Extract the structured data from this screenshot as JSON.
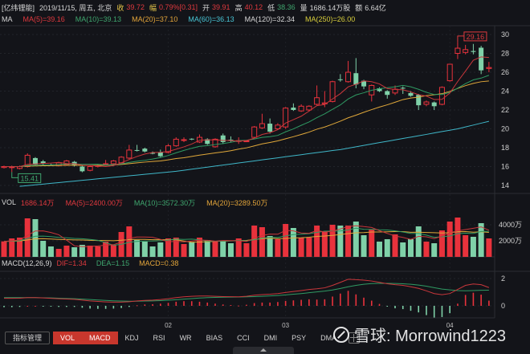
{
  "header": {
    "stock_name": "[亿纬锂能]",
    "date": "2019/11/15, 周五, 北京",
    "close_label": "收",
    "close": "39.72",
    "change_label": "幅",
    "change": "0.79%[0.31]",
    "open_label": "开",
    "open": "39.91",
    "high_label": "高",
    "high": "40.12",
    "low_label": "低",
    "low": "38.36",
    "volume_label": "量",
    "volume": "1686.14万股",
    "amount_label": "额",
    "amount": "6.64亿"
  },
  "ma_legend": {
    "title": "MA",
    "ma5": "MA(5)=39.16",
    "ma10": "MA(10)=39.13",
    "ma20": "MA(20)=37.10",
    "ma60": "MA(60)=36.13",
    "ma120": "MA(120)=32.34",
    "ma250": "MA(250)=26.00"
  },
  "vol_legend": {
    "title": "VOL",
    "value": "1686.14万",
    "ma5": "MA(5)=2400.00万",
    "ma10": "MA(10)=3572.30万",
    "ma20": "MA(20)=3289.50万"
  },
  "macd_legend": {
    "title": "MACD(12,26,9)",
    "dif": "DIF=1.34",
    "dea": "DEA=1.15",
    "macd": "MACD=0.38"
  },
  "tabs": [
    {
      "label": "指标管理",
      "active": false
    },
    {
      "label": "VOL",
      "active": true
    },
    {
      "label": "MACD",
      "active": true
    },
    {
      "label": "KDJ",
      "active": false
    },
    {
      "label": "RSI",
      "active": false
    },
    {
      "label": "WR",
      "active": false
    },
    {
      "label": "BIAS",
      "active": false
    },
    {
      "label": "CCI",
      "active": false
    },
    {
      "label": "DMI",
      "active": false
    },
    {
      "label": "PSY",
      "active": false
    },
    {
      "label": "DMA",
      "active": false
    }
  ],
  "watermark": "雪球: Morrowind1223",
  "colors": {
    "up": "#e8323c",
    "down": "#7fd1a8",
    "flat": "#e6e6e6",
    "ma5": "#c9373b",
    "ma10": "#2f9a63",
    "ma20": "#e0a83a",
    "ma60": "#3fb7c9",
    "bg": "#131419"
  },
  "chart_data": [
    {
      "type": "candlestick",
      "panel": "price",
      "y_ticks": [
        "30",
        "28",
        "26",
        "24",
        "22",
        "20",
        "18",
        "16",
        "14"
      ],
      "ylim": [
        13,
        31
      ],
      "x_tick_labels": [
        {
          "index": 21,
          "label": "02"
        },
        {
          "index": 36,
          "label": "03"
        },
        {
          "index": 57,
          "label": "04"
        }
      ],
      "annotations": [
        {
          "index": 1,
          "label": "15.41",
          "kind": "low"
        },
        {
          "index": 58,
          "label": "29.16",
          "kind": "high"
        }
      ],
      "ohlc": [
        [
          15.9,
          16.0,
          16.1,
          15.8
        ],
        [
          15.95,
          15.97,
          16.1,
          15.41
        ],
        [
          15.8,
          16.0,
          16.1,
          15.7
        ],
        [
          16.0,
          17.2,
          17.4,
          15.9
        ],
        [
          16.9,
          16.2,
          17.0,
          16.1
        ],
        [
          16.55,
          16.3,
          16.7,
          16.2
        ],
        [
          16.2,
          16.15,
          16.3,
          16.1
        ],
        [
          16.1,
          16.4,
          16.5,
          16.0
        ],
        [
          16.2,
          16.6,
          16.7,
          16.1
        ],
        [
          16.5,
          16.1,
          16.6,
          16.0
        ],
        [
          16.0,
          15.5,
          16.1,
          15.4
        ],
        [
          15.6,
          16.0,
          16.1,
          15.5
        ],
        [
          16.05,
          16.1,
          16.2,
          15.9
        ],
        [
          16.25,
          16.3,
          16.7,
          16.2
        ],
        [
          16.3,
          16.6,
          16.7,
          16.2
        ],
        [
          16.4,
          17.0,
          17.1,
          16.3
        ],
        [
          16.9,
          17.75,
          18.3,
          16.8
        ],
        [
          17.75,
          17.7,
          18.3,
          17.6
        ],
        [
          17.9,
          17.6,
          18.0,
          17.5
        ],
        [
          17.45,
          17.4,
          17.6,
          17.3
        ],
        [
          17.5,
          17.1,
          17.8,
          17.0
        ],
        [
          17.5,
          18.2,
          18.4,
          17.4
        ],
        [
          18.2,
          18.9,
          19.1,
          18.1
        ],
        [
          18.8,
          18.85,
          19.1,
          18.6
        ],
        [
          18.95,
          18.9,
          19.0,
          18.8
        ],
        [
          18.6,
          19.1,
          19.4,
          18.5
        ],
        [
          18.9,
          18.4,
          19.0,
          18.3
        ],
        [
          18.1,
          18.9,
          19.0,
          18.0
        ],
        [
          19.3,
          18.6,
          19.5,
          18.4
        ],
        [
          18.85,
          18.8,
          19.2,
          18.6
        ],
        [
          18.7,
          18.75,
          19.1,
          18.4
        ],
        [
          18.65,
          18.72,
          18.8,
          18.6
        ],
        [
          19.1,
          20.2,
          20.3,
          19.0
        ],
        [
          20.1,
          20.55,
          21.6,
          20.0
        ],
        [
          20.55,
          19.7,
          21.1,
          19.5
        ],
        [
          20.0,
          20.4,
          20.6,
          19.9
        ],
        [
          20.2,
          22.2,
          22.3,
          20.0
        ],
        [
          22.25,
          22.0,
          22.7,
          21.9
        ],
        [
          21.9,
          22.4,
          22.6,
          21.8
        ],
        [
          22.0,
          22.4,
          22.5,
          21.9
        ],
        [
          22.6,
          23.3,
          24.6,
          22.5
        ],
        [
          22.65,
          22.75,
          24.0,
          22.3
        ],
        [
          22.9,
          25.0,
          25.1,
          22.8
        ],
        [
          25.25,
          25.2,
          25.8,
          25.0
        ],
        [
          25.0,
          26.0,
          27.2,
          24.9
        ],
        [
          25.9,
          24.7,
          27.5,
          24.3
        ],
        [
          25.1,
          24.5,
          25.2,
          24.2
        ],
        [
          23.6,
          24.6,
          24.7,
          22.9
        ],
        [
          24.3,
          24.0,
          24.4,
          23.9
        ],
        [
          24.0,
          23.6,
          24.1,
          23.2
        ],
        [
          23.8,
          24.2,
          24.6,
          23.6
        ],
        [
          24.35,
          24.3,
          24.5,
          23.7
        ],
        [
          23.8,
          23.5,
          24.0,
          23.4
        ],
        [
          23.6,
          22.5,
          23.7,
          22.0
        ],
        [
          22.6,
          22.85,
          23.0,
          22.4
        ],
        [
          22.8,
          22.4,
          22.9,
          22.0
        ],
        [
          22.6,
          24.4,
          24.5,
          22.5
        ],
        [
          25.1,
          26.85,
          26.9,
          25.0
        ],
        [
          28.0,
          28.55,
          29.16,
          27.4
        ],
        [
          28.1,
          28.4,
          28.9,
          27.9
        ],
        [
          28.25,
          28.15,
          29.0,
          27.9
        ],
        [
          28.6,
          26.2,
          28.8,
          25.8
        ],
        [
          26.4,
          26.5,
          27.1,
          26.0
        ]
      ],
      "ma60": [
        null,
        null,
        13.9,
        13.98,
        14.06,
        14.14,
        14.22,
        14.3,
        14.38,
        14.46,
        14.54,
        14.62,
        14.7,
        14.78,
        14.86,
        14.94,
        15.02,
        15.1,
        15.18,
        15.26,
        15.34,
        15.42,
        15.5,
        15.61,
        15.72,
        15.83,
        15.94,
        16.05,
        16.16,
        16.27,
        16.38,
        16.49,
        16.6,
        16.71,
        16.82,
        16.93,
        17.04,
        17.15,
        17.26,
        17.37,
        17.48,
        17.59,
        17.7,
        17.8,
        17.95,
        18.1,
        18.24,
        18.39,
        18.54,
        18.68,
        18.83,
        18.98,
        19.12,
        19.27,
        19.41,
        19.56,
        19.71,
        19.85,
        20.0,
        20.2,
        20.4,
        20.6,
        20.8
      ]
    },
    {
      "type": "bar",
      "panel": "volume",
      "unit": "万",
      "y_ticks": [
        "4000万",
        "2000万"
      ],
      "values": [
        1930,
        2300,
        2400,
        4800,
        4700,
        2000,
        1300,
        1000,
        1400,
        1200,
        1500,
        1400,
        1300,
        1900,
        1500,
        3100,
        3800,
        2100,
        1900,
        1300,
        1800,
        2300,
        2400,
        1600,
        1800,
        2400,
        2100,
        1900,
        2000,
        1700,
        2300,
        1700,
        3900,
        3700,
        2600,
        2200,
        4100,
        3600,
        2400,
        2400,
        3900,
        3200,
        4000,
        3900,
        3900,
        4400,
        2700,
        3400,
        1900,
        2200,
        2800,
        1800,
        2200,
        3800,
        1900,
        1700,
        3300,
        4400,
        4900,
        2700,
        2500,
        4200,
        2300
      ]
    },
    {
      "type": "line",
      "panel": "macd",
      "y_ticks": [
        "2",
        "0"
      ],
      "dif": [
        0.55,
        0.55,
        0.56,
        0.6,
        0.6,
        0.58,
        0.55,
        0.52,
        0.5,
        0.48,
        0.42,
        0.36,
        0.32,
        0.29,
        0.27,
        0.27,
        0.3,
        0.36,
        0.4,
        0.42,
        0.46,
        0.52,
        0.6,
        0.66,
        0.7,
        0.72,
        0.72,
        0.7,
        0.68,
        0.67,
        0.66,
        0.7,
        0.78,
        0.82,
        0.85,
        0.9,
        0.98,
        1.05,
        1.12,
        1.2,
        1.25,
        1.32,
        1.5,
        1.72,
        1.95,
        1.92,
        1.88,
        1.82,
        1.72,
        1.62,
        1.55,
        1.5,
        1.4,
        1.28,
        1.1,
        0.9,
        0.82,
        0.9,
        1.2,
        1.5,
        1.6,
        1.55,
        1.34
      ],
      "dea": [
        0.6,
        0.6,
        0.6,
        0.6,
        0.6,
        0.59,
        0.58,
        0.56,
        0.54,
        0.52,
        0.49,
        0.46,
        0.43,
        0.4,
        0.37,
        0.35,
        0.34,
        0.34,
        0.35,
        0.36,
        0.38,
        0.41,
        0.45,
        0.49,
        0.53,
        0.57,
        0.6,
        0.62,
        0.63,
        0.64,
        0.65,
        0.66,
        0.68,
        0.7,
        0.73,
        0.76,
        0.8,
        0.85,
        0.9,
        0.96,
        1.02,
        1.08,
        1.16,
        1.27,
        1.4,
        1.5,
        1.58,
        1.63,
        1.65,
        1.65,
        1.64,
        1.62,
        1.58,
        1.52,
        1.44,
        1.33,
        1.23,
        1.17,
        1.12,
        1.1,
        1.12,
        1.14,
        1.15
      ]
    }
  ]
}
